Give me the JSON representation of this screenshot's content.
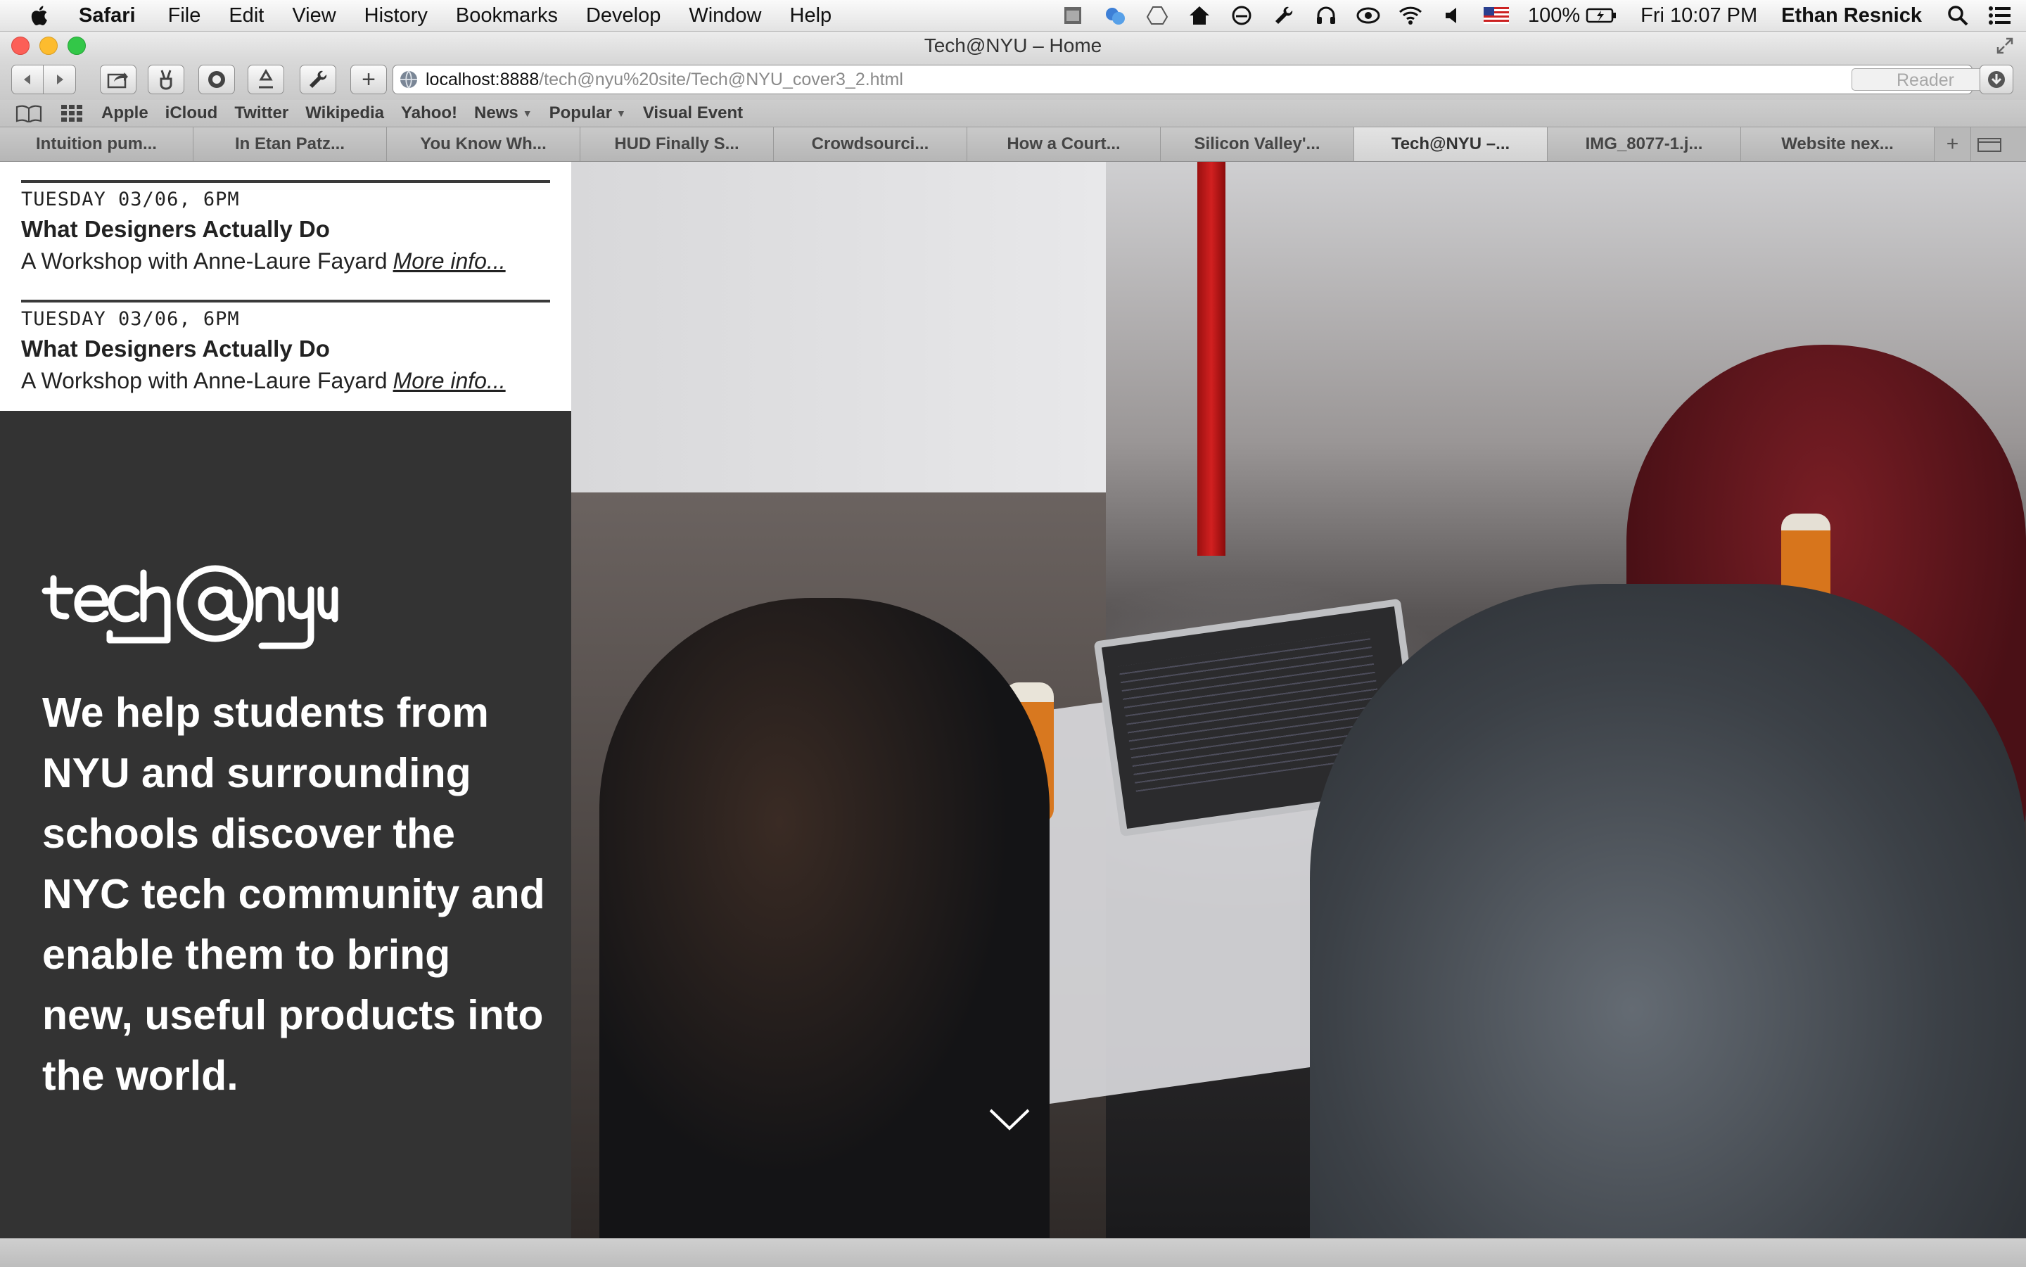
{
  "menubar": {
    "app": "Safari",
    "items": [
      "File",
      "Edit",
      "View",
      "History",
      "Bookmarks",
      "Develop",
      "Window",
      "Help"
    ],
    "battery": "100%",
    "clock": "Fri 10:07 PM",
    "user": "Ethan Resnick"
  },
  "window": {
    "title": "Tech@NYU – Home"
  },
  "toolbar": {
    "url_host": "localhost:8888",
    "url_path": "/tech@nyu%20site/Tech@NYU_cover3_2.html",
    "reader_label": "Reader",
    "add_label": "+"
  },
  "bookmarks": {
    "items": [
      "Apple",
      "iCloud",
      "Twitter",
      "Wikipedia",
      "Yahoo!",
      "News",
      "Popular",
      "Visual Event"
    ]
  },
  "tabs": {
    "items": [
      "Intuition pum...",
      "In Etan Patz...",
      "You Know Wh...",
      "HUD Finally S...",
      "Crowdsourci...",
      "How a Court...",
      "Silicon Valley'...",
      "Tech@NYU –...",
      "IMG_8077-1.j...",
      "Website nex..."
    ],
    "active_index": 7,
    "add_label": "+"
  },
  "page": {
    "events": [
      {
        "date": "TUESDAY 03/06, 6PM",
        "title": "What Designers Actually Do",
        "subtitle": "A Workshop with Anne-Laure Fayard",
        "more": "More info..."
      },
      {
        "date": "TUESDAY 03/06, 6PM",
        "title": "What Designers Actually Do",
        "subtitle": "A Workshop with Anne-Laure Fayard",
        "more": "More info..."
      }
    ],
    "logo_text": "tech@nyu",
    "mission": "We help students from NYU and surrounding schools discover the NYC tech community and enable them to bring new, useful products into the world."
  },
  "colors": {
    "left_panel_bg": "#333333",
    "event_panel_bg": "#ffffff",
    "mission_text": "#ffffff"
  },
  "icons": [
    "apple-icon",
    "cloud-sync-icon",
    "drive-icon",
    "home-icon",
    "circle-slash-icon",
    "wrench-icon",
    "headphones-icon",
    "eye-icon",
    "wifi-icon",
    "volume-icon",
    "flag-us-icon",
    "battery-icon",
    "search-icon",
    "list-icon",
    "globe-icon",
    "reload-icon",
    "download-icon",
    "chevron-down-icon"
  ]
}
